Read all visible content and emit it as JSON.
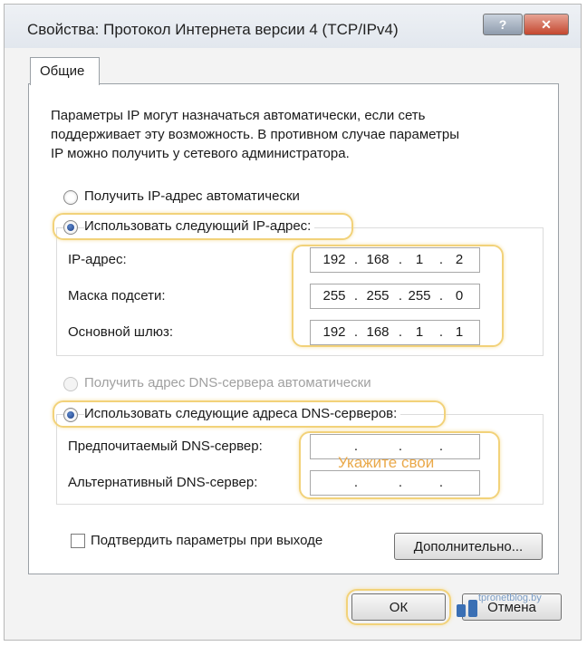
{
  "window": {
    "title": "Свойства: Протокол Интернета версии 4 (TCP/IPv4)",
    "help_label": "?",
    "close_label": "✕"
  },
  "tabs": [
    {
      "label": "Общие",
      "active": true
    }
  ],
  "description_lines": [
    "Параметры IP могут назначаться автоматически, если сеть",
    "поддерживает эту возможность. В противном случае параметры",
    "IP можно получить у сетевого администратора."
  ],
  "ip_section": {
    "auto_label": "Получить IP-адрес автоматически",
    "manual_label": "Использовать следующий IP-адрес:",
    "selected": "manual",
    "fields": [
      {
        "label": "IP-адрес:",
        "octets": [
          "192",
          "168",
          "1",
          "2"
        ]
      },
      {
        "label": "Маска подсети:",
        "octets": [
          "255",
          "255",
          "255",
          "0"
        ]
      },
      {
        "label": "Основной шлюз:",
        "octets": [
          "192",
          "168",
          "1",
          "1"
        ]
      }
    ]
  },
  "dns_section": {
    "auto_label": "Получить адрес DNS-сервера автоматически",
    "manual_label": "Использовать следующие адреса DNS-серверов:",
    "selected": "manual",
    "fields": [
      {
        "label": "Предпочитаемый DNS-сервер:",
        "octets": [
          "",
          "",
          "",
          ""
        ]
      },
      {
        "label": "Альтернативный DNS-сервер:",
        "octets": [
          "",
          "",
          "",
          ""
        ]
      }
    ],
    "annotation": "Укажите свои"
  },
  "validate_label": "Подтвердить параметры при выходе",
  "validate_checked": false,
  "buttons": {
    "advanced": "Дополнительно...",
    "ok": "ОК",
    "cancel": "Отмена"
  },
  "watermark": "tpronetblog.by",
  "colors": {
    "highlight": "#f2d27a",
    "annotation": "#eaa94a",
    "radio_selected": "#1d3f86",
    "close_button": "#c4472f"
  }
}
